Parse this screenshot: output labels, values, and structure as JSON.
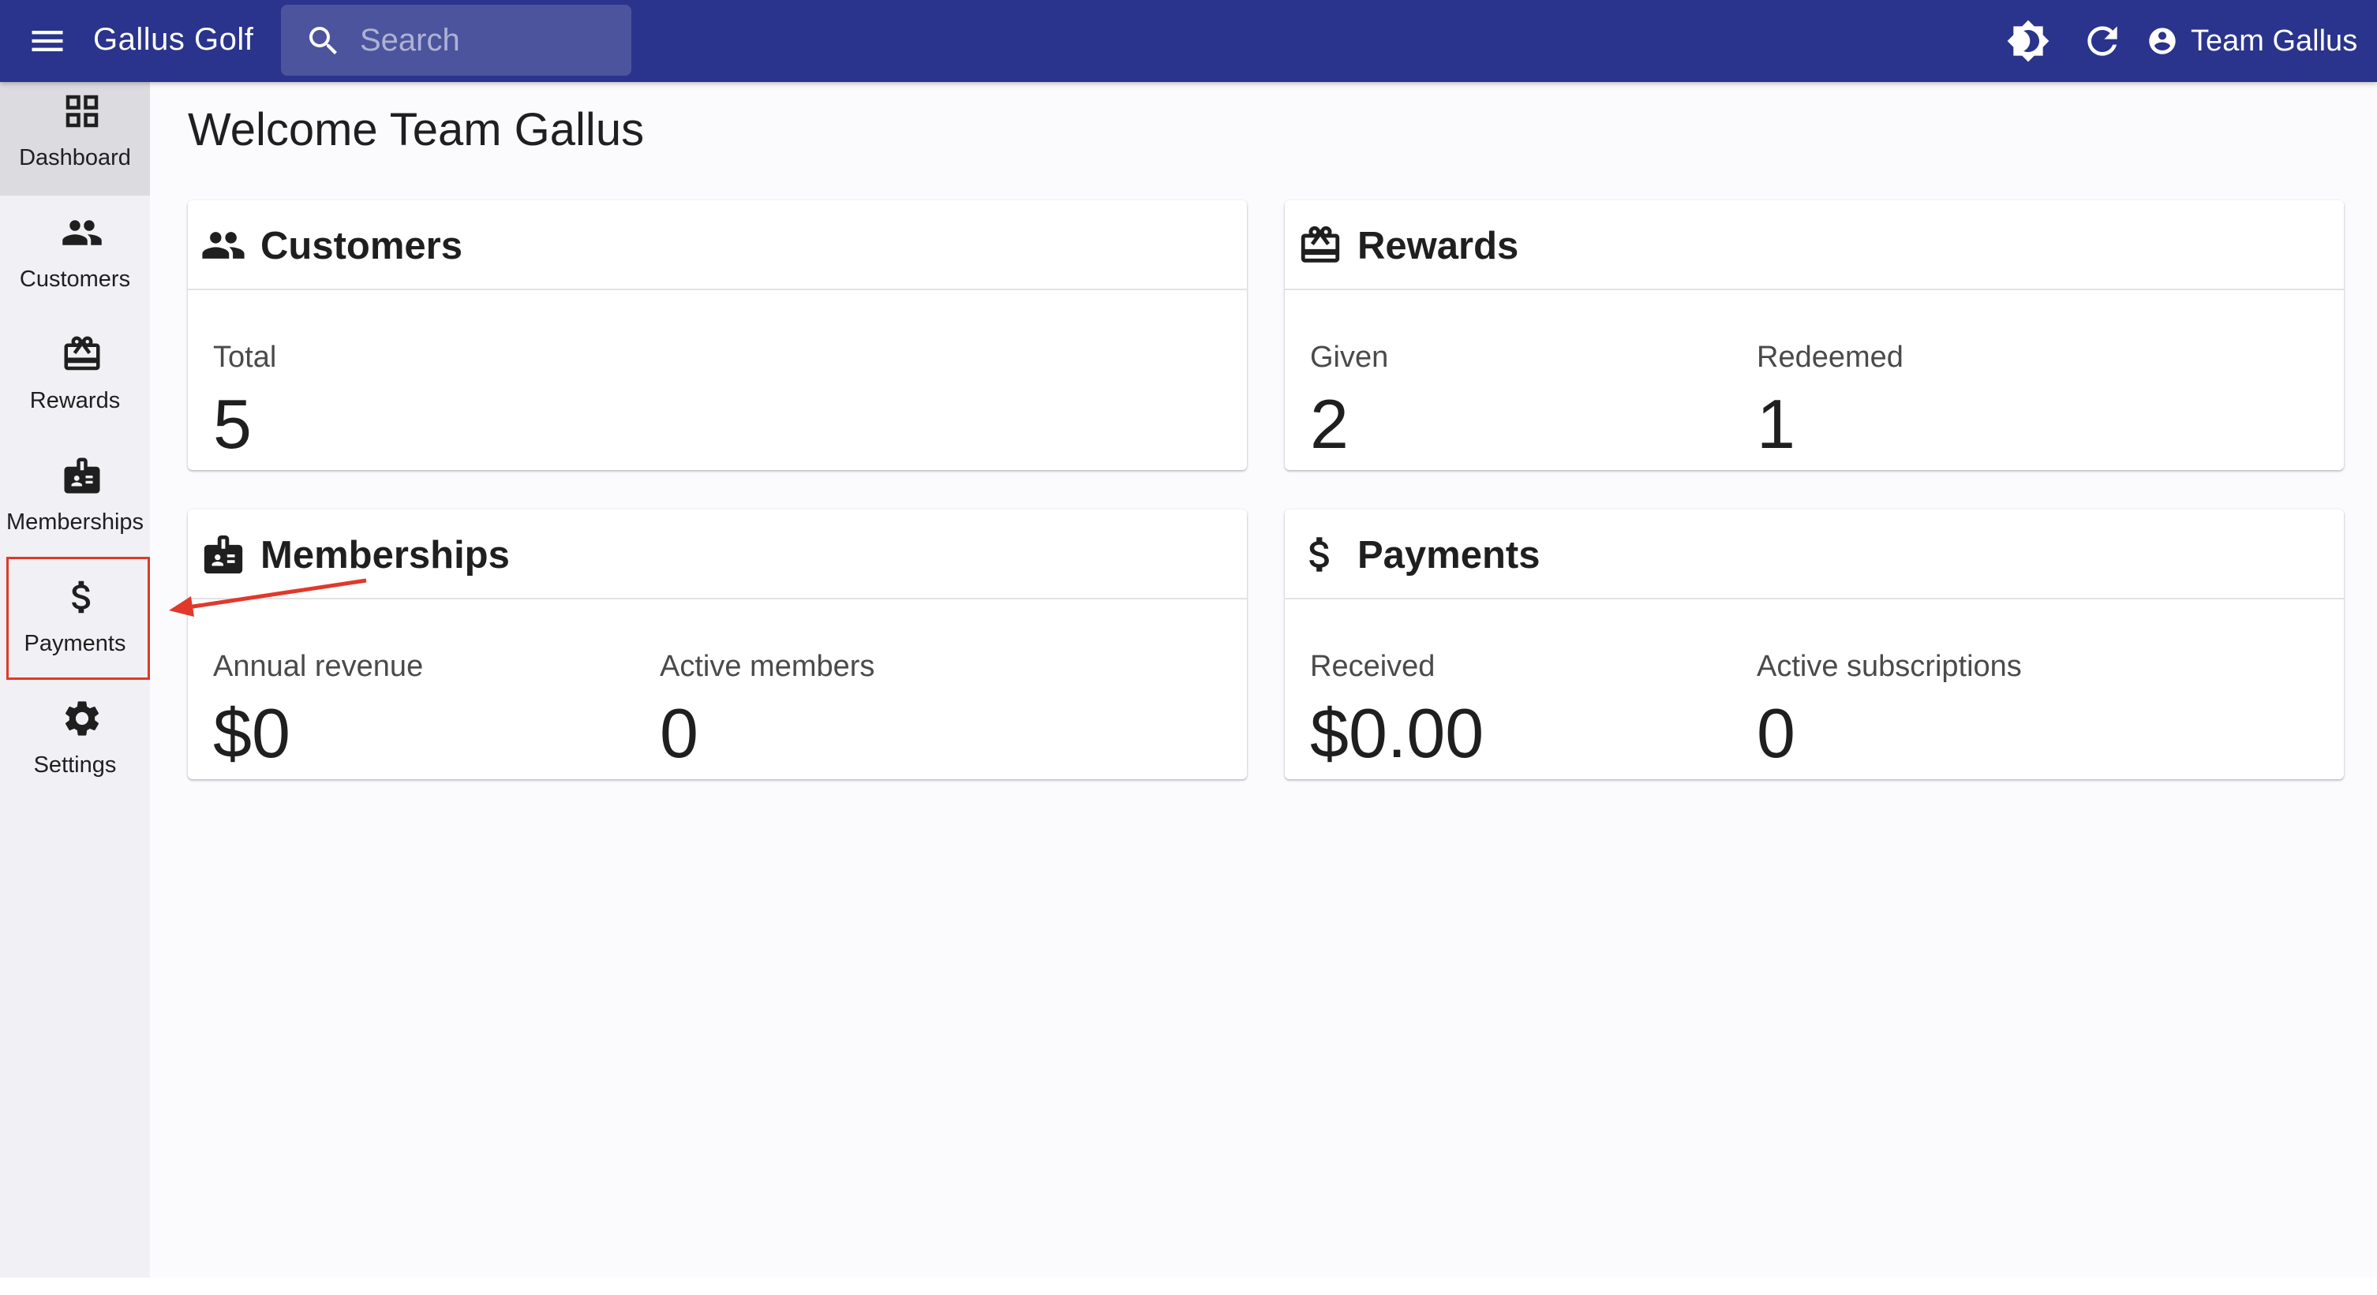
{
  "app": {
    "title": "Gallus Golf",
    "user_name": "Team Gallus"
  },
  "search": {
    "placeholder": "Search",
    "value": ""
  },
  "toolbar": {
    "icons": [
      "menu-icon",
      "search-icon",
      "brightness-icon",
      "refresh-icon",
      "account-circle-icon"
    ]
  },
  "sidebar": {
    "items": [
      {
        "label": "Dashboard",
        "icon": "dashboard-icon",
        "active": true
      },
      {
        "label": "Customers",
        "icon": "people-icon",
        "active": false
      },
      {
        "label": "Rewards",
        "icon": "gift-card-icon",
        "active": false
      },
      {
        "label": "Memberships",
        "icon": "id-badge-icon",
        "active": false
      },
      {
        "label": "Payments",
        "icon": "dollar-icon",
        "active": false
      },
      {
        "label": "Settings",
        "icon": "gear-icon",
        "active": false
      }
    ]
  },
  "main": {
    "welcome": "Welcome Team Gallus",
    "cards": {
      "customers": {
        "title": "Customers",
        "stats": [
          {
            "label": "Total",
            "value": "5"
          }
        ]
      },
      "rewards": {
        "title": "Rewards",
        "stats": [
          {
            "label": "Given",
            "value": "2"
          },
          {
            "label": "Redeemed",
            "value": "1"
          }
        ]
      },
      "memberships": {
        "title": "Memberships",
        "stats": [
          {
            "label": "Annual revenue",
            "value": "$0"
          },
          {
            "label": "Active members",
            "value": "0"
          }
        ]
      },
      "payments": {
        "title": "Payments",
        "stats": [
          {
            "label": "Received",
            "value": "$0.00"
          },
          {
            "label": "Active subscriptions",
            "value": "0"
          }
        ]
      }
    }
  },
  "colors": {
    "appbar": "#2a348c",
    "sidebar": "#f1f0f4",
    "sidebar_active": "#dcdbe0",
    "annotation": "#e0392b"
  }
}
